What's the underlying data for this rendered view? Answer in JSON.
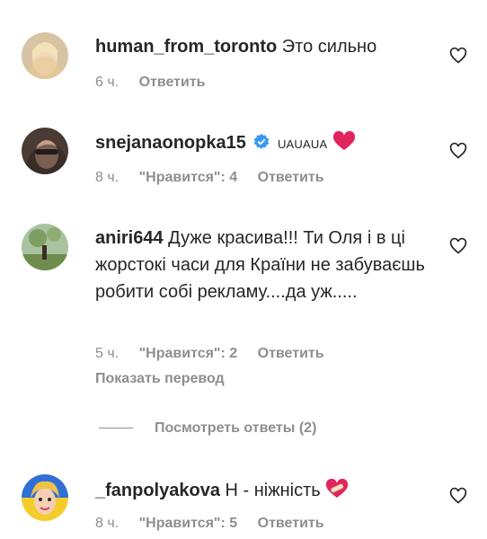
{
  "comments": [
    {
      "username": "human_from_toronto",
      "text": "Это сильно",
      "time": "6 ч.",
      "reply": "Ответить"
    },
    {
      "username": "snejanaonopka15",
      "text": "UAUAUA",
      "time": "8 ч.",
      "likes": "\"Нравится\": 4",
      "reply": "Ответить"
    },
    {
      "username": "aniri644",
      "text": "Дуже красива!!! Ти Оля і в ці жорстокі часи для Країни не забуваєшь робити собі рекламу....да уж.....",
      "time": "5 ч.",
      "likes": "\"Нравится\": 2",
      "reply": "Ответить",
      "translate": "Показать перевод",
      "view_replies": "Посмотреть ответы (2)"
    },
    {
      "username": "_fanpolyakova",
      "text": "Н - ніжність",
      "time": "8 ч.",
      "likes": "\"Нравится\": 5",
      "reply": "Ответить"
    }
  ],
  "colors": {
    "text": "#262626",
    "meta": "#8e8e8e",
    "verified": "#3897f0",
    "heart_red": "#e0245e"
  }
}
